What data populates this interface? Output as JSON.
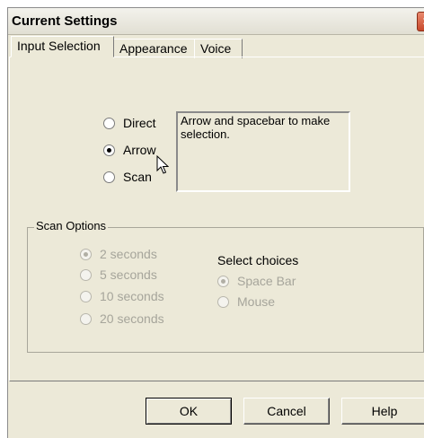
{
  "window": {
    "title": "Current Settings",
    "close_symbol": "✕"
  },
  "tabs": [
    "Input Selection",
    "Appearance",
    "Voice"
  ],
  "input_method": {
    "options": [
      "Direct",
      "Arrow",
      "Scan"
    ],
    "selected": "Arrow",
    "description": "Arrow and spacebar to make selection."
  },
  "scan_options": {
    "label": "Scan Options",
    "intervals": [
      "2 seconds",
      "5 seconds",
      "10 seconds",
      "20 seconds"
    ],
    "selected_interval": "2 seconds",
    "select_choices_label": "Select choices",
    "choices": [
      "Space Bar",
      "Mouse"
    ],
    "selected_choice": "Space Bar",
    "enabled": false
  },
  "buttons": {
    "ok": "OK",
    "cancel": "Cancel",
    "help": "Help"
  }
}
